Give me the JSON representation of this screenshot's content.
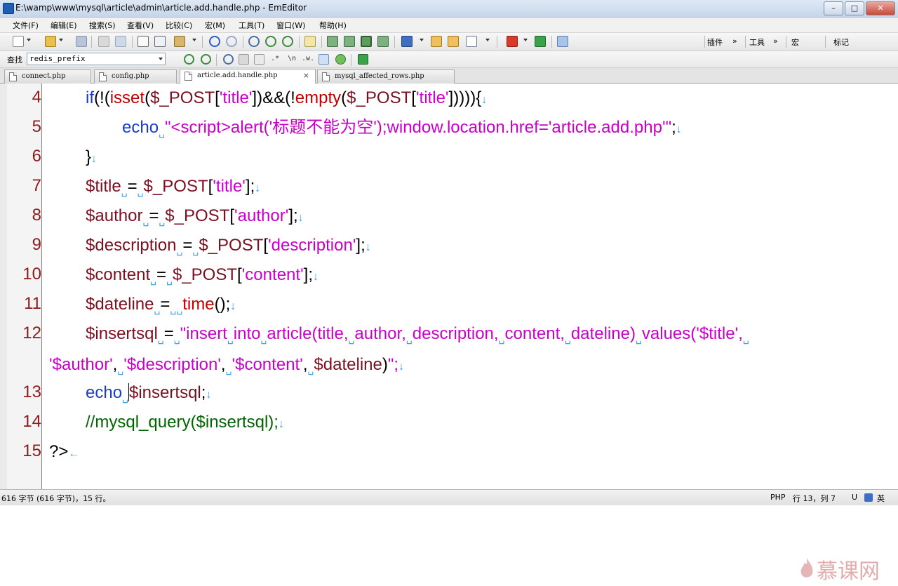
{
  "window": {
    "title": "E:\\wamp\\www\\mysql\\article\\admin\\article.add.handle.php - EmEditor",
    "minimize": "–",
    "maximize": "□",
    "close": "✕"
  },
  "menu": [
    "文件(F)",
    "编辑(E)",
    "搜索(S)",
    "查看(V)",
    "比较(C)",
    "宏(M)",
    "工具(T)",
    "窗口(W)",
    "帮助(H)"
  ],
  "toolbar": {
    "plugins_label": "插件",
    "tools_label": "工具",
    "macro_label": "宏",
    "marker_label": "标记",
    "chevron": "»"
  },
  "search": {
    "label": "查找",
    "value": "redis_prefix",
    "regex_btn": ".*",
    "newline_btn": "\\n",
    "word_btn": ".w."
  },
  "tabs": [
    {
      "label": "connect.php",
      "active": false
    },
    {
      "label": "config.php",
      "active": false
    },
    {
      "label": "article.add.handle.php",
      "active": true,
      "close": "×"
    },
    {
      "label": "mysql_affected_rows.php",
      "active": false
    }
  ],
  "lines": [
    {
      "num": "4",
      "text": "if(!(isset($_POST['title'])&&(!empty($_POST['title'])))){"
    },
    {
      "num": "5",
      "text": "echo \"<script>alert('标题不能为空');window.location.href='article.add.php'\";"
    },
    {
      "num": "6",
      "text": "}"
    },
    {
      "num": "7",
      "text": "$title = $_POST['title'];"
    },
    {
      "num": "8",
      "text": "$author = $_POST['author'];"
    },
    {
      "num": "9",
      "text": "$description = $_POST['description'];"
    },
    {
      "num": "10",
      "text": "$content = $_POST['content'];"
    },
    {
      "num": "11",
      "text": "$dateline =  time();"
    },
    {
      "num": "12",
      "text": "$insertsql = \"insert into article(title, author, description, content, dateline) values('$title', '$author', '$description', '$content', $dateline)\";"
    },
    {
      "num": "13",
      "text": "echo $insertsql;"
    },
    {
      "num": "14",
      "text": "//mysql_query($insertsql);"
    },
    {
      "num": "15",
      "text": "?>"
    }
  ],
  "status": {
    "left": "616 字节 (616 字节)，15 行。",
    "lang": "PHP",
    "position": "行 13，列 7",
    "encoding": "U",
    "ime": "英"
  },
  "watermark": "慕课网",
  "colors": {
    "keyword": "#1a3cc8",
    "function": "#c00000",
    "string": "#c800c8",
    "variable": "#7a1020",
    "comment": "#006400",
    "whitespace_mark": "#3da2e6",
    "line_number": "#8b1c1c"
  }
}
